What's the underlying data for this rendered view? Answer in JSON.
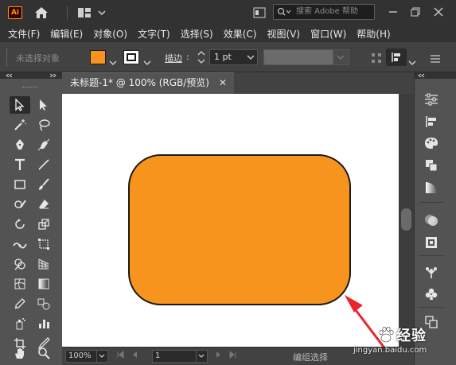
{
  "app": {
    "logo_text": "Ai",
    "title_icons": [
      "home-icon",
      "workspace-layout-icon",
      "chevron-down-icon",
      "panel-toggle-icon"
    ],
    "search_placeholder": "搜索 Adobe 帮助"
  },
  "window_controls": [
    "minimize-icon",
    "restore-icon",
    "close-icon"
  ],
  "menu": [
    "文件(F)",
    "编辑(E)",
    "对象(O)",
    "文字(T)",
    "选择(S)",
    "效果(C)",
    "视图(V)",
    "窗口(W)",
    "帮助(H)"
  ],
  "control_bar": {
    "selection_label": "未选择对象",
    "fill_color": "#f7931e",
    "stroke_label": "描边",
    "stroke_colon": ":",
    "stroke_weight": "1 pt",
    "style_color": "#6b6b6b"
  },
  "document": {
    "tab_title": "未标题-1* @ 100% (RGB/预览)",
    "close_glyph": "✕"
  },
  "artwork": {
    "shape_fill": "#f7941e",
    "shape_stroke": "#1a1a1a",
    "arrow_color": "#e8262c"
  },
  "statusbar": {
    "zoom": "100%",
    "page": "1",
    "status_text": "编组选择"
  },
  "watermark": {
    "brand": "经验",
    "url": "jingyan.baidu.com"
  },
  "tools": [
    "selection-tool-icon",
    "direct-selection-tool-icon",
    "magic-wand-tool-icon",
    "lasso-tool-icon",
    "pen-tool-icon",
    "curvature-tool-icon",
    "type-tool-icon",
    "line-segment-tool-icon",
    "rectangle-tool-icon",
    "paintbrush-tool-icon",
    "shaper-tool-icon",
    "eraser-tool-icon",
    "rotate-tool-icon",
    "scale-tool-icon",
    "width-tool-icon",
    "free-transform-tool-icon",
    "shape-builder-tool-icon",
    "perspective-grid-tool-icon",
    "mesh-tool-icon",
    "gradient-tool-icon",
    "eyedropper-tool-icon",
    "blend-tool-icon",
    "symbol-sprayer-tool-icon",
    "column-graph-tool-icon",
    "artboard-tool-icon",
    "slice-tool-icon",
    "hand-tool-icon",
    "zoom-tool-icon"
  ],
  "right_panel_icons": [
    "properties-icon",
    "align-icon",
    "color-guide-icon",
    "pathfinder-icon",
    "gradient-panel-icon",
    "transparency-icon",
    "appearance-icon",
    "symbols-icon",
    "club-symbol-icon",
    "artboards-icon"
  ]
}
